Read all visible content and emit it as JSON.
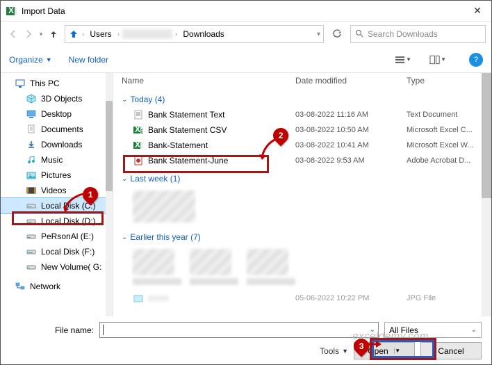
{
  "window": {
    "title": "Import Data"
  },
  "path": {
    "seg1": "Users",
    "seg2": "Downloads"
  },
  "search": {
    "placeholder": "Search Downloads"
  },
  "toolbar": {
    "organize": "Organize",
    "newfolder": "New folder"
  },
  "sidebar": {
    "items": [
      {
        "label": "This PC"
      },
      {
        "label": "3D Objects"
      },
      {
        "label": "Desktop"
      },
      {
        "label": "Documents"
      },
      {
        "label": "Downloads"
      },
      {
        "label": "Music"
      },
      {
        "label": "Pictures"
      },
      {
        "label": "Videos"
      },
      {
        "label": "Local Disk (C:)"
      },
      {
        "label": "Local Disk (D:)"
      },
      {
        "label": "PeRsonAl (E:)"
      },
      {
        "label": "Local Disk (F:)"
      },
      {
        "label": "New Volume( G:"
      },
      {
        "label": "Network"
      }
    ]
  },
  "columns": {
    "name": "Name",
    "date": "Date modified",
    "type": "Type"
  },
  "groups": {
    "g1": {
      "header": "Today (4)"
    },
    "g2": {
      "header": "Last week (1)"
    },
    "g3": {
      "header": "Earlier this year (7)"
    }
  },
  "files": {
    "f1": {
      "name": "Bank Statement Text",
      "date": "03-08-2022 11:16 AM",
      "type": "Text Document"
    },
    "f2": {
      "name": "Bank Statement CSV",
      "date": "03-08-2022 10:50 AM",
      "type": "Microsoft Excel C..."
    },
    "f3": {
      "name": "Bank-Statement",
      "date": "03-08-2022 10:41 AM",
      "type": "Microsoft Excel W..."
    },
    "f4": {
      "name": "Bank Statement-June",
      "date": "03-08-2022 9:53 AM",
      "type": "Adobe Acrobat D..."
    },
    "f5": {
      "name": "",
      "date": "05-06-2022 10:22 PM",
      "type": "JPG File"
    }
  },
  "footer": {
    "filename_label": "File name:",
    "filter": "All Files",
    "tools": "Tools",
    "open": "Open",
    "cancel": "Cancel"
  },
  "watermark": "exceldemy.com"
}
